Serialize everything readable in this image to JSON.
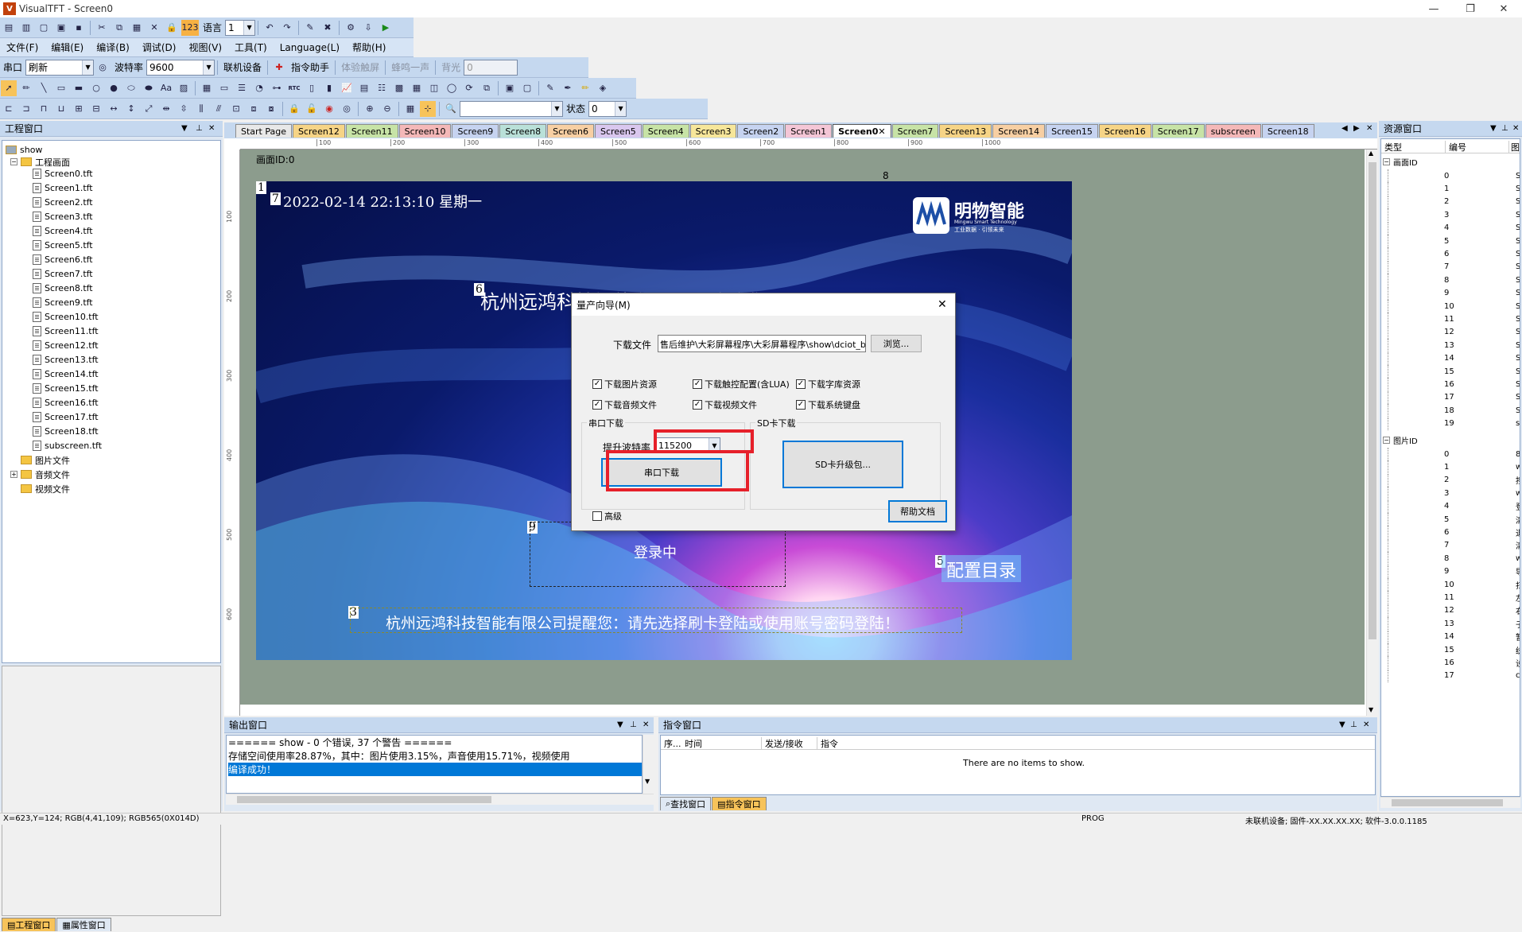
{
  "window": {
    "title": "VisualTFT - Screen0",
    "icon_label": "V"
  },
  "toolbar1": {
    "lang_label": "语言",
    "lang_value": "1"
  },
  "menubar": [
    "文件(F)",
    "编辑(E)",
    "编译(B)",
    "调试(D)",
    "视图(V)",
    "工具(T)",
    "Language(L)",
    "帮助(H)"
  ],
  "toolbar2": {
    "serial_label": "串口",
    "serial_value": "刷新",
    "baud_label": "波特率",
    "baud_value": "9600",
    "connect_label": "联机设备",
    "cmd_helper_label": "指令助手",
    "touch_label": "体验触屏",
    "beep_label": "蜂鸣一声",
    "backlight_label": "背光",
    "backlight_value": "0"
  },
  "toolbar3": {
    "rtc_label": "RTC"
  },
  "toolbar4": {
    "state_label": "状态",
    "state_value": "0"
  },
  "project_panel": {
    "title": "工程窗口",
    "root": "show",
    "screens_folder": "工程画面",
    "files": [
      "Screen0.tft",
      "Screen1.tft",
      "Screen2.tft",
      "Screen3.tft",
      "Screen4.tft",
      "Screen5.tft",
      "Screen6.tft",
      "Screen7.tft",
      "Screen8.tft",
      "Screen9.tft",
      "Screen10.tft",
      "Screen11.tft",
      "Screen12.tft",
      "Screen13.tft",
      "Screen14.tft",
      "Screen15.tft",
      "Screen16.tft",
      "Screen17.tft",
      "Screen18.tft",
      "subscreen.tft"
    ],
    "folders": [
      "图片文件",
      "音频文件",
      "视频文件"
    ],
    "bottom_tabs": [
      "工程窗口",
      "属性窗口"
    ]
  },
  "tabs": [
    {
      "label": "Start Page",
      "color": "#e8e8e8"
    },
    {
      "label": "Screen12",
      "color": "#f6d486"
    },
    {
      "label": "Screen11",
      "color": "#c7e3a6"
    },
    {
      "label": "Screen10",
      "color": "#f4b8b8"
    },
    {
      "label": "Screen9",
      "color": "#c6d3f0"
    },
    {
      "label": "Screen8",
      "color": "#b9e0d8"
    },
    {
      "label": "Screen6",
      "color": "#f7cfa3"
    },
    {
      "label": "Screen5",
      "color": "#d9c7ee"
    },
    {
      "label": "Screen4",
      "color": "#c7e3a6"
    },
    {
      "label": "Screen3",
      "color": "#f6e69a"
    },
    {
      "label": "Screen2",
      "color": "#c6d3f0"
    },
    {
      "label": "Screen1",
      "color": "#f4c6d6"
    },
    {
      "label": "Screen0",
      "color": "#ffffff",
      "active": true
    },
    {
      "label": "Screen7",
      "color": "#c7e3a6"
    },
    {
      "label": "Screen13",
      "color": "#f6d486"
    },
    {
      "label": "Screen14",
      "color": "#f7cfa3"
    },
    {
      "label": "Screen15",
      "color": "#c6d3f0"
    },
    {
      "label": "Screen16",
      "color": "#f6d486"
    },
    {
      "label": "Screen17",
      "color": "#c7e3a6"
    },
    {
      "label": "subscreen",
      "color": "#f4b8b8"
    },
    {
      "label": "Screen18",
      "color": "#c6d3f0"
    }
  ],
  "ruler_ticks": [
    "100",
    "200",
    "300",
    "400",
    "500",
    "600",
    "700",
    "800",
    "900",
    "1000"
  ],
  "ruler_v_ticks": [
    "100",
    "200",
    "300",
    "400",
    "500",
    "600"
  ],
  "canvas": {
    "screen_id_label": "画面ID:0",
    "marker8": "8",
    "ctrl1": "1",
    "datetime": "2022-02-14 22:13:10 星期一",
    "datetime_num": "7",
    "brand_name": "明物智能",
    "brand_sub": "Mingwu Smart Technology",
    "brand_slogan": "工业数据 · 引领未来",
    "ctrl6": "6",
    "welcome": "杭州远鸿科技智能有限公司欢迎您",
    "ctrl9": "9",
    "login_text": "登录中",
    "ctrl5": "5",
    "config_text": "配置目录",
    "ctrl3": "3",
    "notice": "杭州远鸿科技智能有限公司提醒您：请先选择刷卡登陆或使用账号密码登陆！"
  },
  "dialog": {
    "title": "量产向导(M)",
    "file_label": "下载文件",
    "file_path": "售后维护\\大彩屏幕程序\\大彩屏幕程序\\show\\dciot_build\\",
    "browse": "浏览...",
    "checks": [
      {
        "label": "下载图片资源",
        "checked": true
      },
      {
        "label": "下载触控配置(含LUA)",
        "checked": true
      },
      {
        "label": "下载字库资源",
        "checked": true
      },
      {
        "label": "下载音频文件",
        "checked": true
      },
      {
        "label": "下载视频文件",
        "checked": true
      },
      {
        "label": "下载系统键盘",
        "checked": true
      }
    ],
    "serial_group": "串口下载",
    "baud_label": "提升波特率",
    "baud_value": "115200",
    "serial_btn": "串口下载",
    "sd_group": "SD卡下载",
    "sd_btn": "SD卡升级包...",
    "advanced": "高级",
    "help_btn": "帮助文档"
  },
  "output_panel": {
    "title": "输出窗口",
    "lines": [
      "======  show - 0 个错误, 37 个警告  ======",
      "存储空间使用率28.87%，其中：图片使用3.15%，声音使用15.71%，视频使用",
      "编译成功！"
    ]
  },
  "cmd_panel": {
    "title": "指令窗口",
    "columns": [
      "序...",
      "时间",
      "发送/接收",
      "指令"
    ],
    "empty": "There are no items to show.",
    "bottom_tabs": [
      "查找窗口",
      "指令窗口"
    ]
  },
  "resource_panel": {
    "title": "资源窗口",
    "col_type": "类型",
    "col_num": "编号",
    "col_extra": "图",
    "group1": "画面ID",
    "group1_rows": [
      {
        "n": "0",
        "v": "S"
      },
      {
        "n": "1",
        "v": "S"
      },
      {
        "n": "2",
        "v": "S"
      },
      {
        "n": "3",
        "v": "S"
      },
      {
        "n": "4",
        "v": "S"
      },
      {
        "n": "5",
        "v": "S"
      },
      {
        "n": "6",
        "v": "S"
      },
      {
        "n": "7",
        "v": "S"
      },
      {
        "n": "8",
        "v": "S"
      },
      {
        "n": "9",
        "v": "S"
      },
      {
        "n": "10",
        "v": "S"
      },
      {
        "n": "11",
        "v": "S"
      },
      {
        "n": "12",
        "v": "S"
      },
      {
        "n": "13",
        "v": "S"
      },
      {
        "n": "14",
        "v": "S"
      },
      {
        "n": "15",
        "v": "S"
      },
      {
        "n": "16",
        "v": "S"
      },
      {
        "n": "17",
        "v": "S"
      },
      {
        "n": "18",
        "v": "S"
      },
      {
        "n": "19",
        "v": "su"
      }
    ],
    "group2": "图片ID",
    "group2_rows": [
      {
        "n": "0",
        "v": "8"
      },
      {
        "n": "1",
        "v": "w"
      },
      {
        "n": "2",
        "v": "按"
      },
      {
        "n": "3",
        "v": "w"
      },
      {
        "n": "4",
        "v": "登"
      },
      {
        "n": "5",
        "v": "清"
      },
      {
        "n": "6",
        "v": "退"
      },
      {
        "n": "7",
        "v": "清"
      },
      {
        "n": "8",
        "v": "w"
      },
      {
        "n": "9",
        "v": "导"
      },
      {
        "n": "10",
        "v": "扫"
      },
      {
        "n": "11",
        "v": "左"
      },
      {
        "n": "12",
        "v": "右"
      },
      {
        "n": "13",
        "v": "子"
      },
      {
        "n": "14",
        "v": "暂"
      },
      {
        "n": "15",
        "v": "统"
      },
      {
        "n": "16",
        "v": "设"
      },
      {
        "n": "17",
        "v": "cl"
      }
    ]
  },
  "statusbar": {
    "coords": "X=623,Y=124; RGB(4,41,109); RGB565(0X014D)",
    "mode": "PROG",
    "device": "未联机设备; 固件-XX.XX.XX.XX; 软件-3.0.0.1185"
  }
}
